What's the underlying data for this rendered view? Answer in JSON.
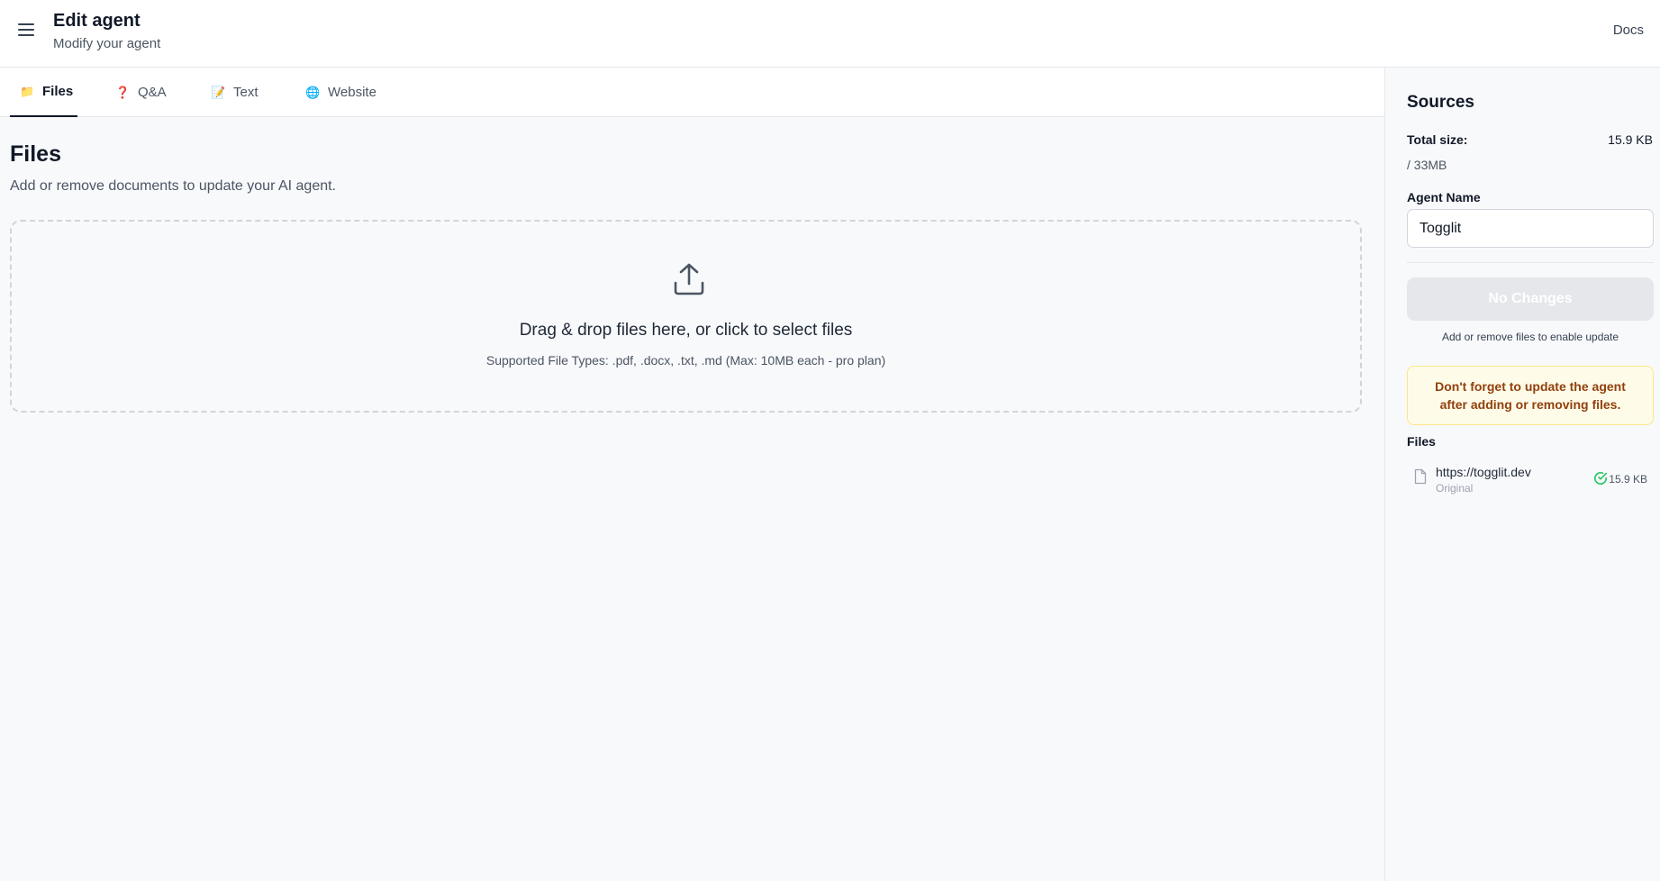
{
  "header": {
    "title": "Edit agent",
    "subtitle": "Modify your agent",
    "docs_label": "Docs"
  },
  "tabs": [
    {
      "label": "Files",
      "icon": "folder-icon",
      "emoji": "📁",
      "active": true
    },
    {
      "label": "Q&A",
      "icon": "question-icon",
      "emoji": "❓",
      "active": false
    },
    {
      "label": "Text",
      "icon": "memo-icon",
      "emoji": "📝",
      "active": false
    },
    {
      "label": "Website",
      "icon": "globe-icon",
      "emoji": "🌐",
      "active": false
    }
  ],
  "main": {
    "title": "Files",
    "description": "Add or remove documents to update your AI agent.",
    "dropzone": {
      "title": "Drag & drop files here, or click to select files",
      "subtitle": "Supported File Types: .pdf, .docx, .txt, .md (Max: 10MB each - pro plan)"
    }
  },
  "sidebar": {
    "title": "Sources",
    "total_label": "Total size:",
    "total_value": "15.9 KB",
    "limit": "/ 33MB",
    "agent_name_label": "Agent Name",
    "agent_name_value": "Togglit",
    "button_label": "No Changes",
    "hint": "Add or remove files to enable update",
    "warning": "Don't forget to update the agent after adding or removing files.",
    "files_label": "Files",
    "files": [
      {
        "name": "https://togglit.dev",
        "sub": "Original",
        "size": "15.9 KB",
        "status": "ok"
      }
    ]
  },
  "colors": {
    "accent": "#111827",
    "warning_bg": "#fefce8",
    "warning_text": "#92400e",
    "success": "#22c55e"
  }
}
